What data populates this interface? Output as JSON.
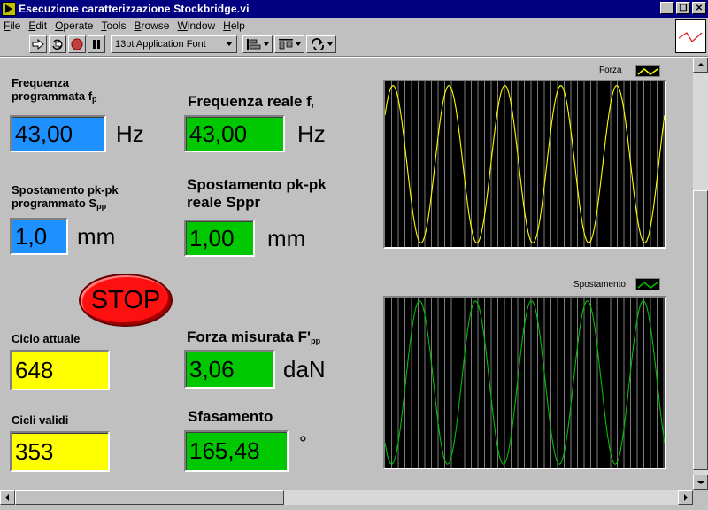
{
  "window": {
    "title": "Esecuzione caratterizzazione Stockbridge.vi",
    "buttons": {
      "minimize": "_",
      "restore": "❐",
      "close": "✕"
    }
  },
  "menu": [
    {
      "u": "F",
      "rest": "ile"
    },
    {
      "u": "E",
      "rest": "dit"
    },
    {
      "u": "O",
      "rest": "perate"
    },
    {
      "u": "T",
      "rest": "ools"
    },
    {
      "u": "B",
      "rest": "rowse"
    },
    {
      "u": "W",
      "rest": "indow"
    },
    {
      "u": "H",
      "rest": "elp"
    }
  ],
  "toolbar": {
    "font": "13pt Application Font",
    "icons": [
      "run-arrow-icon",
      "run-continuous-icon",
      "abort-icon",
      "pause-icon",
      "align-icon",
      "distribute-icon",
      "reorder-icon"
    ]
  },
  "panel": {
    "freq_prog": {
      "label_1": "Frequenza",
      "label_2": "programmata f",
      "label_sub": "p",
      "value": "43,00",
      "unit": "Hz",
      "color": "#1e90ff"
    },
    "freq_real": {
      "label": "Frequenza reale f",
      "label_sub": "r",
      "value": "43,00",
      "unit": "Hz",
      "color": "#00c800"
    },
    "disp_prog": {
      "label_1": "Spostamento pk-pk",
      "label_2": "programmato S",
      "label_sub": "pp",
      "value": "1,0",
      "unit": "mm"
    },
    "disp_real": {
      "label_1": "Spostamento pk-pk",
      "label_2": "reale Sppr",
      "value": "1,00",
      "unit": "mm"
    },
    "stop_label": "STOP",
    "cycle_current": {
      "label": "Ciclo attuale",
      "value": "648",
      "color": "#ffff00"
    },
    "cycles_valid": {
      "label": "Cicli validi",
      "value": "353"
    },
    "force": {
      "label": "Forza misurata F'",
      "label_sub": "pp",
      "value": "3,06",
      "unit": "daN"
    },
    "phase": {
      "label": "Sfasamento",
      "value": "165,48",
      "unit": "°"
    }
  },
  "chart_data": [
    {
      "type": "line",
      "series": [
        {
          "name": "Forza",
          "color": "#ffff00",
          "shape": "sine",
          "cycles_shown": 5,
          "starts_at": "peak-falling"
        }
      ],
      "grid": "vertical-only",
      "legend": "top-right"
    },
    {
      "type": "line",
      "series": [
        {
          "name": "Spostamento",
          "color": "#00c000",
          "shape": "sine",
          "cycles_shown": 5
        }
      ],
      "grid": "vertical-only",
      "legend": "top-right"
    }
  ]
}
